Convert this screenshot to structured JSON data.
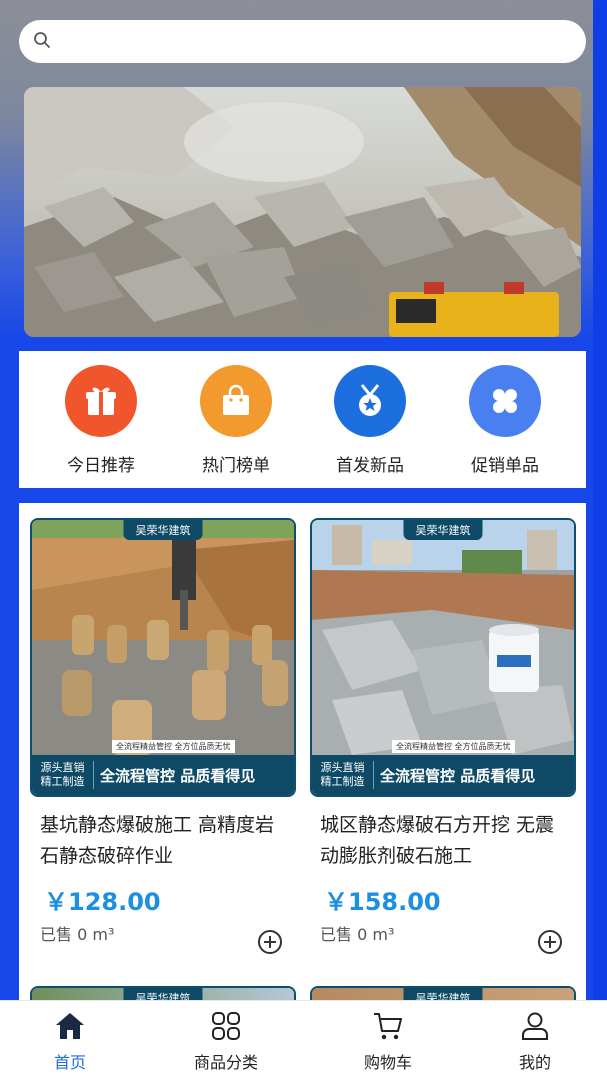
{
  "search": {
    "placeholder": ""
  },
  "categories": [
    {
      "label": "今日推荐",
      "icon": "gift-icon",
      "color": "#f0552b"
    },
    {
      "label": "热门榜单",
      "icon": "shopping-bag-icon",
      "color": "#f29a2e"
    },
    {
      "label": "首发新品",
      "icon": "medal-icon",
      "color": "#1d6fe0"
    },
    {
      "label": "促销单品",
      "icon": "clover-icon",
      "color": "#4a7ff0"
    }
  ],
  "products": [
    {
      "tag": "吴荣华建筑",
      "badge_line1": "源头直销",
      "badge_line2": "精工制造",
      "slogan": "全流程管控 品质看得见",
      "sub_slogan": "全流程精益管控  全方位品质无忧",
      "title": "基坑静态爆破施工 高精度岩石静态破碎作业",
      "price": "￥128.00",
      "sold": "已售 0 m³"
    },
    {
      "tag": "吴荣华建筑",
      "badge_line1": "源头直销",
      "badge_line2": "精工制造",
      "slogan": "全流程管控 品质看得见",
      "sub_slogan": "全流程精益管控  全方位品质无忧",
      "title": "城区静态爆破石方开挖 无震动膨胀剂破石施工",
      "price": "￥158.00",
      "sold": "已售 0 m³"
    }
  ],
  "peek_tags": [
    "吴荣华建筑",
    "吴荣华建筑"
  ],
  "tabbar": [
    {
      "label": "首页",
      "icon": "home-icon",
      "active": true
    },
    {
      "label": "商品分类",
      "icon": "category-grid-icon",
      "active": false
    },
    {
      "label": "购物车",
      "icon": "cart-icon",
      "active": false
    },
    {
      "label": "我的",
      "icon": "user-icon",
      "active": false
    }
  ],
  "colors": {
    "accent": "#1d6fe0",
    "price": "#1d8fe0",
    "background": "#1747e8"
  }
}
